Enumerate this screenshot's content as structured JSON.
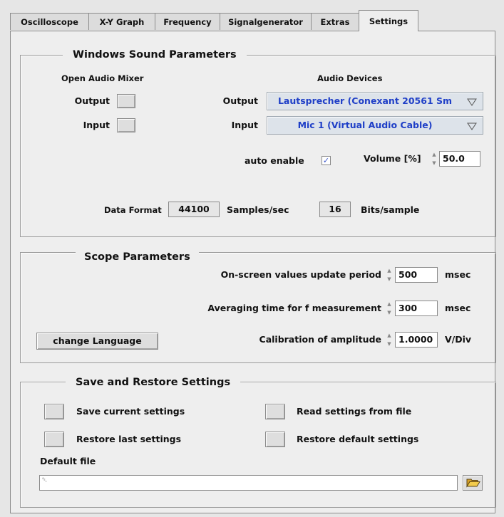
{
  "tabs": [
    {
      "label": "Oscilloscope"
    },
    {
      "label": "X-Y Graph"
    },
    {
      "label": "Frequency"
    },
    {
      "label": "Signalgenerator"
    },
    {
      "label": "Extras"
    },
    {
      "label": "Settings"
    }
  ],
  "active_tab": "Settings",
  "sound": {
    "title": "Windows Sound Parameters",
    "mixer_header": "Open Audio Mixer",
    "devices_header": "Audio Devices",
    "mixer_output_label": "Output",
    "mixer_input_label": "Input",
    "device_output_label": "Output",
    "device_input_label": "Input",
    "output_device": "Lautsprecher (Conexant 20561 Sm",
    "input_device": "Mic 1 (Virtual Audio Cable)",
    "auto_enable_label": "auto enable",
    "auto_enable_mark": "✓",
    "volume_label": "Volume [%]",
    "volume_value": "50.0",
    "data_format_label": "Data Format",
    "sample_rate": "44100",
    "samples_unit": "Samples/sec",
    "bits": "16",
    "bits_unit": "Bits/sample"
  },
  "scope": {
    "title": "Scope Parameters",
    "update_label": "On-screen values update period",
    "update_value": "500",
    "update_unit": "msec",
    "averaging_label": "Averaging time for f measurement",
    "averaging_value": "300",
    "averaging_unit": "msec",
    "calibration_label": "Calibration of amplitude",
    "calibration_value": "1.0000",
    "calibration_unit": "V/Div",
    "language_button": "change Language"
  },
  "save": {
    "title": "Save and Restore Settings",
    "save_current": "Save current settings",
    "restore_last": "Restore last settings",
    "read_file": "Read settings from file",
    "restore_default": "Restore default settings",
    "default_file_label": "Default file",
    "default_file_value": "",
    "path_glyph": "␡"
  },
  "colors": {
    "accent": "#1f3fc7",
    "panel": "#eeeeee",
    "ring_bg": "#dde3ea"
  },
  "icons": {
    "dropdown": "triangle-down-icon",
    "folder": "folder-open-icon",
    "spinner": "up-down-spinner-icon"
  }
}
